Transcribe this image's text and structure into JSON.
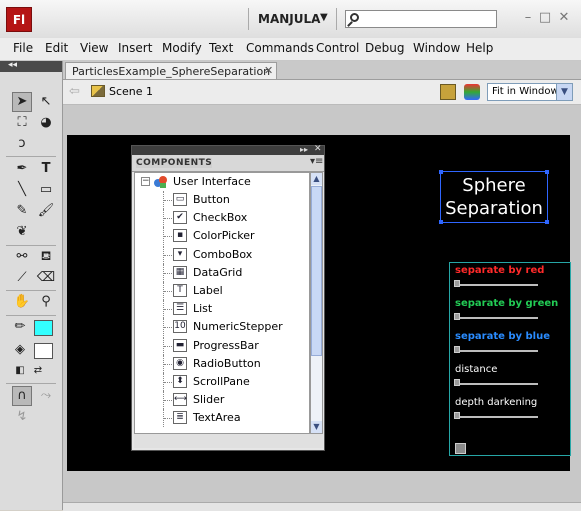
{
  "app": {
    "logo": "Fl",
    "workspace": "MANJULA",
    "window_buttons": [
      "–",
      "□",
      "✕"
    ]
  },
  "menu": [
    "File",
    "Edit",
    "View",
    "Insert",
    "Modify",
    "Text",
    "Commands",
    "Control",
    "Debug",
    "Window",
    "Help"
  ],
  "document": {
    "tab": "ParticlesExample_SphereSeparation",
    "tab_close": "✕",
    "scene": "Scene 1",
    "zoom": "Fit in Window"
  },
  "stage": {
    "title_line1": "Sphere",
    "title_line2": "Separation",
    "controls": [
      {
        "label": "separate by red",
        "color": "#ff2a2a",
        "value": 0
      },
      {
        "label": "separate by green",
        "color": "#22cc55",
        "value": 0
      },
      {
        "label": "separate by blue",
        "color": "#2a8cff",
        "value": 0
      },
      {
        "label": "distance",
        "color": "#ffffff",
        "value": 0
      },
      {
        "label": "depth darkening",
        "color": "#ffffff",
        "value": 0
      }
    ]
  },
  "tools": {
    "stroke_color": "#33ffff",
    "fill_color": "#ffffff"
  },
  "components": {
    "title": "COMPONENTS",
    "root": "User Interface",
    "items": [
      "Button",
      "CheckBox",
      "ColorPicker",
      "ComboBox",
      "DataGrid",
      "Label",
      "List",
      "NumericStepper",
      "ProgressBar",
      "RadioButton",
      "ScrollPane",
      "Slider",
      "TextArea"
    ]
  }
}
